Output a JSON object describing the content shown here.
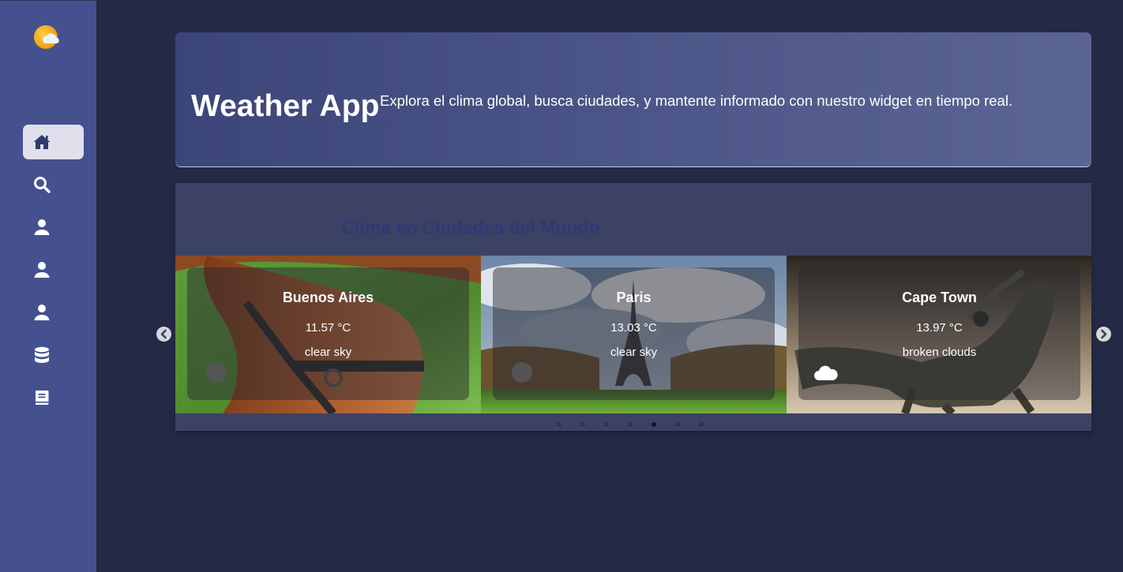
{
  "sidebar": {
    "logo": "weather-logo-icon",
    "items": [
      {
        "icon": "home-icon",
        "active": true
      },
      {
        "icon": "search-icon",
        "active": false
      },
      {
        "icon": "user-icon",
        "active": false
      },
      {
        "icon": "user-icon",
        "active": false
      },
      {
        "icon": "user-icon",
        "active": false
      },
      {
        "icon": "database-icon",
        "active": false
      },
      {
        "icon": "book-icon",
        "active": false
      }
    ]
  },
  "hero": {
    "title": "Weather App",
    "description": "Explora el clima global, busca ciudades, y mantente informado con nuestro widget en tiempo real."
  },
  "cities_section": {
    "title": "Clima en Ciudades del Mundo",
    "cards": [
      {
        "city": "Buenos Aires",
        "temp": "11.57 °C",
        "desc": "clear sky",
        "icon": "clear-sky-icon",
        "image": "horse"
      },
      {
        "city": "Paris",
        "temp": "13.03 °C",
        "desc": "clear sky",
        "icon": "clear-sky-icon",
        "image": "eiffel-tower"
      },
      {
        "city": "Cape Town",
        "temp": "13.97 °C",
        "desc": "broken clouds",
        "icon": "cloud-icon",
        "image": "iguana"
      }
    ],
    "carousel": {
      "dot_count": 7,
      "active_dot": 5
    }
  },
  "colors": {
    "background": "#242a45",
    "sidebar": "#45518f",
    "accent": "#2f3978",
    "panel": "#3c4263"
  }
}
